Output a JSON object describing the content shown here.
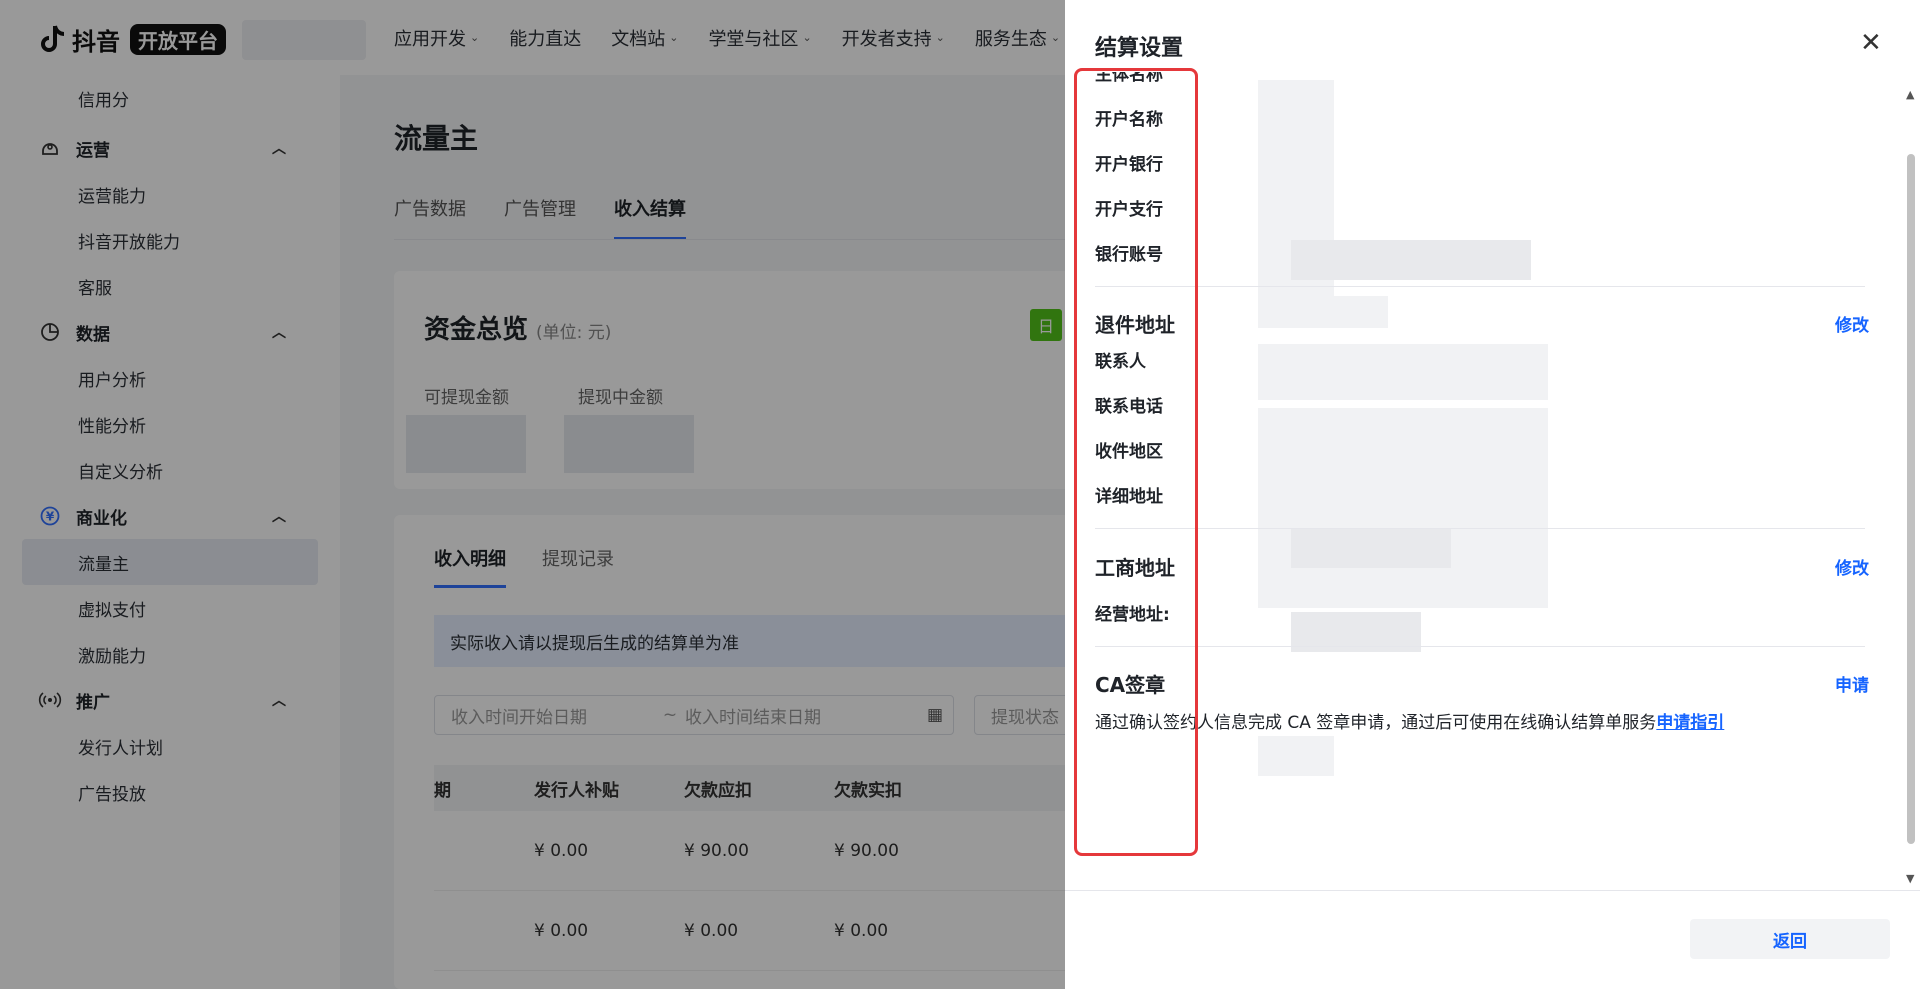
{
  "topnav": {
    "brand": "抖音",
    "badge": "开放平台",
    "items": [
      {
        "label": "应用开发",
        "chevron": true
      },
      {
        "label": "能力直达",
        "chevron": false
      },
      {
        "label": "文档站",
        "chevron": true
      },
      {
        "label": "学堂与社区",
        "chevron": true
      },
      {
        "label": "开发者支持",
        "chevron": true
      },
      {
        "label": "服务生态",
        "chevron": true
      }
    ]
  },
  "sidebar": {
    "credit": "信用分",
    "ops": {
      "label": "运营",
      "items": [
        "运营能力",
        "抖音开放能力",
        "客服"
      ]
    },
    "data": {
      "label": "数据",
      "items": [
        "用户分析",
        "性能分析",
        "自定义分析"
      ]
    },
    "biz": {
      "label": "商业化",
      "items": [
        "流量主",
        "虚拟支付",
        "激励能力"
      ]
    },
    "promo": {
      "label": "推广",
      "items": [
        "发行人计划",
        "广告投放"
      ]
    }
  },
  "main": {
    "title": "流量主",
    "tabs": [
      "广告数据",
      "广告管理",
      "收入结算"
    ],
    "overview": {
      "title": "资金总览",
      "unit": "(单位: 元)",
      "badge": "日",
      "withdrawable": "可提现金额",
      "withdrawing": "提现中金额"
    },
    "subtabs": [
      "收入明细",
      "提现记录"
    ],
    "notice": "实际收入请以提现后生成的结算单为准",
    "date_start_placeholder": "收入时间开始日期",
    "date_sep": "~",
    "date_end_placeholder": "收入时间结束日期",
    "status_placeholder": "提现状态",
    "table": {
      "headers": [
        "期",
        "发行人补贴",
        "欠款应扣",
        "欠款实扣"
      ],
      "rows": [
        [
          "¥ 0.00",
          "¥ 90.00",
          "¥ 90.00"
        ],
        [
          "¥ 0.00",
          "¥ 0.00",
          "¥ 0.00"
        ]
      ]
    }
  },
  "drawer": {
    "title": "结算设置",
    "close": "✕",
    "fields_account": [
      "主体名称",
      "开户名称",
      "开户银行",
      "开户支行",
      "银行账号"
    ],
    "return_section": {
      "title": "退件地址",
      "edit": "修改",
      "fields": [
        "联系人",
        "联系电话",
        "收件地区",
        "详细地址"
      ]
    },
    "business_section": {
      "title": "工商地址",
      "edit": "修改",
      "fields": [
        "经营地址:"
      ]
    },
    "ca_section": {
      "title": "CA签章",
      "action": "申请",
      "desc": "通过确认签约人信息完成 CA 签章申请，通过后可使用在线确认结算单服务",
      "link": "申请指引"
    },
    "back_button": "返回"
  },
  "colors": {
    "accent": "#1664ff",
    "highlight": "#e5383b",
    "overlay": "rgba(0,0,0,0.4)"
  }
}
